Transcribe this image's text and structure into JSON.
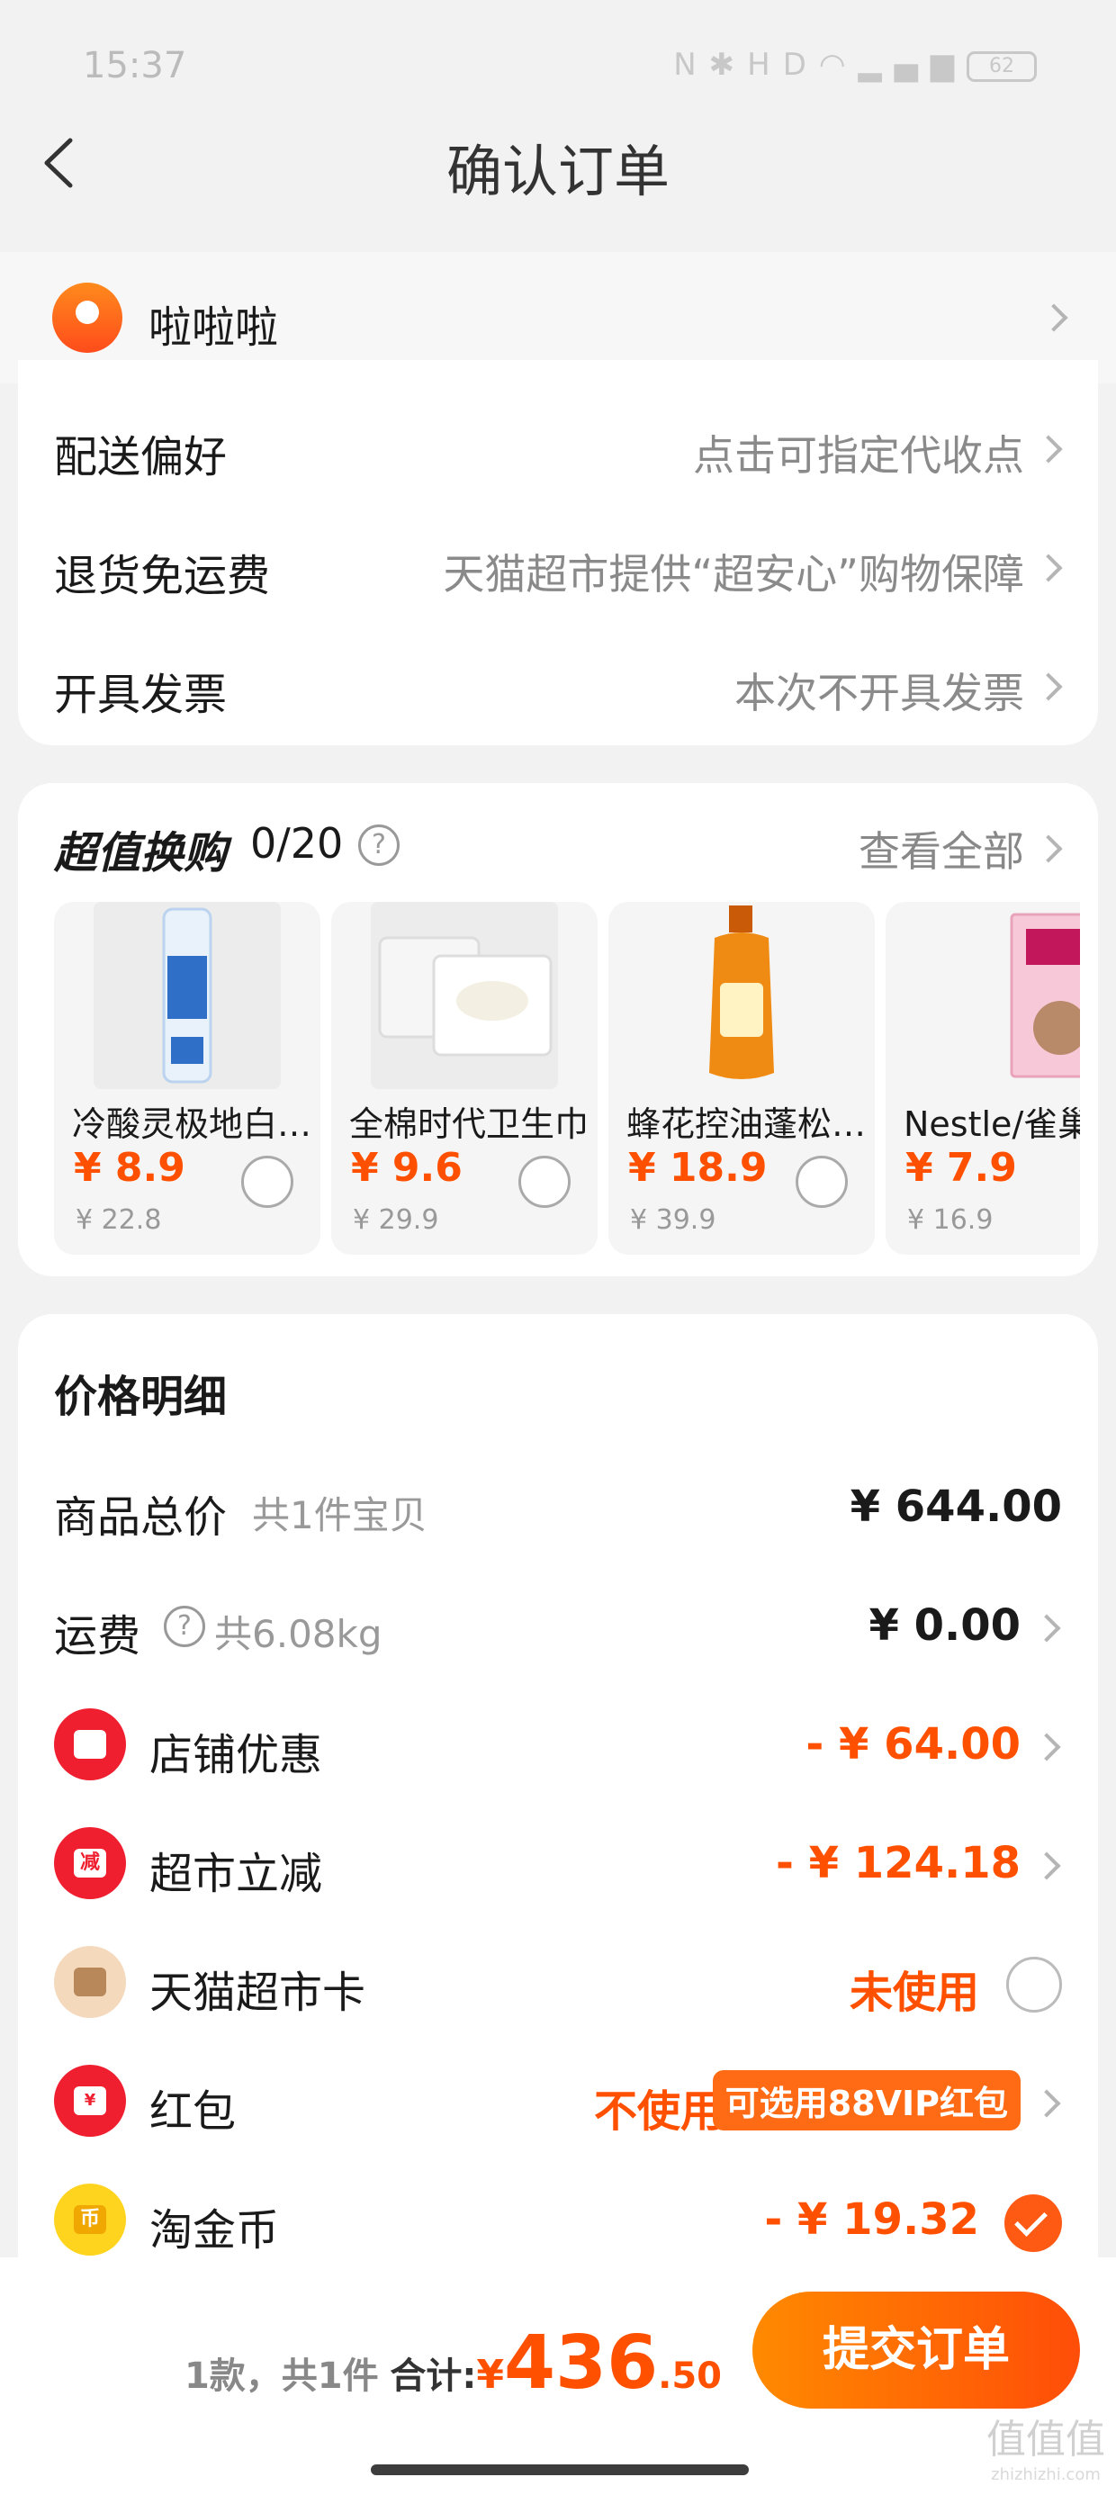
{
  "status_bar": {
    "time": "15:37",
    "battery": "62"
  },
  "header": {
    "title": "确认订单"
  },
  "address": {
    "name": "啦啦啦"
  },
  "options": [
    {
      "label": "配送偏好",
      "value": "点击可指定代收点"
    },
    {
      "label": "退货免运费",
      "value": "天猫超市提供“超安心”购物保障"
    },
    {
      "label": "开具发票",
      "value": "本次不开具发票"
    }
  ],
  "swap": {
    "title": "超值换购",
    "count": "0/20",
    "view_all": "查看全部",
    "products": [
      {
        "name": "冷酸灵极地白牙膏",
        "price": "¥ 8.9",
        "original": "¥ 22.8"
      },
      {
        "name": "全棉时代卫生巾",
        "price": "¥ 9.6",
        "original": "¥ 29.9"
      },
      {
        "name": "蜂花控油蓬松洗发水",
        "price": "¥ 18.9",
        "original": "¥ 39.9"
      },
      {
        "name": "Nestle/雀巢",
        "price": "¥ 7.9",
        "original": "¥ 16.9"
      }
    ]
  },
  "price_detail": {
    "title": "价格明细",
    "rows": [
      {
        "label": "商品总价",
        "sub": "共1件宝贝",
        "value": "¥ 644.00"
      },
      {
        "label": "运费",
        "sub": "共6.08kg",
        "value": "¥ 0.00"
      },
      {
        "label": "店铺优惠",
        "value": "- ¥ 64.00"
      },
      {
        "label": "超市立减",
        "value": "- ¥ 124.18",
        "icon_text": "减"
      },
      {
        "label": "天猫超市卡",
        "value": "未使用"
      },
      {
        "label": "红包",
        "value": "不使用",
        "badge": "可选用88VIP红包"
      },
      {
        "label": "淘金币",
        "value": "- ¥ 19.32"
      }
    ]
  },
  "footer": {
    "count": "1款，共1件",
    "total_label": "合计:",
    "currency": "¥",
    "total_int": "436",
    "total_dec": ".50",
    "submit": "提交订单",
    "watermark": "值值值",
    "watermark_url": "zhizhizhi.com"
  },
  "colors": {
    "accent": "#ff5000",
    "background": "#f2f2f2"
  }
}
